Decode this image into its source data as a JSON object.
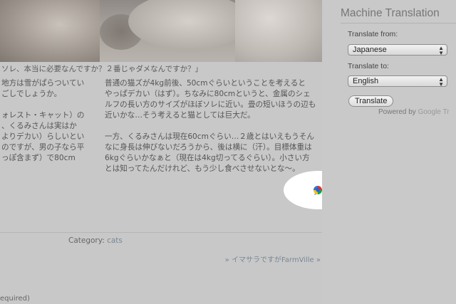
{
  "photo": {
    "description_icon": "cat-fur-photo"
  },
  "post": {
    "caption": "ソレ、本当に必要なんですか？２番じゃダメなんですか？」",
    "left_column": [
      "地方は雪がぱらついてい",
      "ごしでしょうか。",
      "",
      "ォレスト・キャット）の",
      "、くるみさんは実はか",
      "よりデカい）らしいとい",
      "のですが、男の子なら平",
      "っぽ含まず）で80cm"
    ],
    "right_column_p1": [
      "普通の猫ズが4kg前後、50cmぐらいということを考えると",
      "やっぱデカい（はず）。ちなみに80cmというと、金属のシェ",
      "ルフの長い方のサイズがほぼソレに近い。畳の短いほうの辺も",
      "近いかな…そう考えると猫としては巨大だ。"
    ],
    "right_column_p2": [
      "一方、くるみさんは現在60cmぐらい…２歳とはいえもうそん",
      "なに身長は伸びないだろうから、後は横に（汗）。目標体重は",
      "6kgぐらいかなぁと（現在は4kg切ってるぐらい）。小さい方",
      "とは知ってたんだけれど、もう少し食べさせないとな～。"
    ],
    "category_label": "Category:",
    "category_value": "cats",
    "next_link": "» イマサラですがFarmVille »",
    "required_text": "equired)"
  },
  "overlay": {
    "icon": "google-translate-bubble-icon"
  },
  "sidebar": {
    "title": "Machine Translation",
    "from_label": "Translate from:",
    "from_value": "Japanese",
    "to_label": "Translate to:",
    "to_value": "English",
    "button_label": "Translate",
    "powered_prefix": "Powered by",
    "powered_brand": "Google Tr"
  },
  "colors": {
    "dim_background": "#c8c8c8",
    "link": "#7a8792"
  }
}
